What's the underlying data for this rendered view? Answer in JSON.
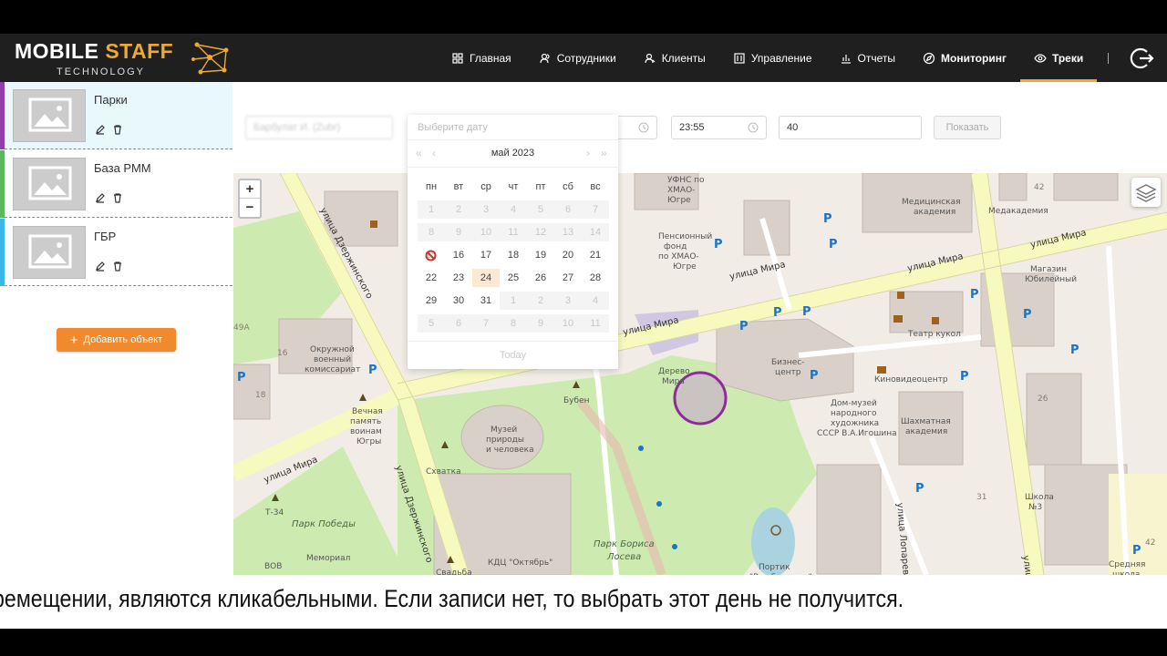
{
  "header": {
    "logo": {
      "main_a": "MOBILE ",
      "main_b": "STAFF",
      "sub": "TECHNOLOGY"
    },
    "nav": [
      {
        "label": "Главная",
        "icon": "grid-icon"
      },
      {
        "label": "Сотрудники",
        "icon": "users-icon"
      },
      {
        "label": "Клиенты",
        "icon": "client-icon"
      },
      {
        "label": "Управление",
        "icon": "manage-icon"
      },
      {
        "label": "Отчеты",
        "icon": "chart-icon"
      },
      {
        "label": "Мониторинг",
        "icon": "compass-icon"
      },
      {
        "label": "Треки",
        "icon": "eye-icon"
      }
    ],
    "logout_icon": "logout-icon"
  },
  "sidebar": {
    "objects": [
      {
        "title": "Парки",
        "color": "#8e3fa8"
      },
      {
        "title": "База РММ",
        "color": "#5cb85c"
      },
      {
        "title": "ГБР",
        "color": "#38b7e8"
      }
    ],
    "add_label": "Добавить объект"
  },
  "filter": {
    "employee": "Барбулат И. (Zubr)",
    "time_to": "23:55",
    "distance": "40",
    "show_label": "Показать"
  },
  "calendar": {
    "placeholder": "Выберите дату",
    "month": "май 2023",
    "weekdays": [
      "пн",
      "вт",
      "ср",
      "чт",
      "пт",
      "сб",
      "вс"
    ],
    "weeks": [
      [
        [
          "1",
          "dis"
        ],
        [
          "2",
          "dis"
        ],
        [
          "3",
          "dis"
        ],
        [
          "4",
          "dis"
        ],
        [
          "5",
          "dis"
        ],
        [
          "6",
          "dis"
        ],
        [
          "7",
          "dis"
        ]
      ],
      [
        [
          "8",
          "dis"
        ],
        [
          "9",
          "dis"
        ],
        [
          "10",
          "dis"
        ],
        [
          "11",
          "dis"
        ],
        [
          "12",
          "dis"
        ],
        [
          "13",
          "dis"
        ],
        [
          "14",
          "dis"
        ]
      ],
      [
        [
          "15",
          "ban"
        ],
        [
          "16",
          ""
        ],
        [
          "17",
          ""
        ],
        [
          "18",
          ""
        ],
        [
          "19",
          ""
        ],
        [
          "20",
          ""
        ],
        [
          "21",
          ""
        ]
      ],
      [
        [
          "22",
          ""
        ],
        [
          "23",
          ""
        ],
        [
          "24",
          "cur"
        ],
        [
          "25",
          ""
        ],
        [
          "26",
          ""
        ],
        [
          "27",
          ""
        ],
        [
          "28",
          ""
        ]
      ],
      [
        [
          "29",
          ""
        ],
        [
          "30",
          ""
        ],
        [
          "31",
          ""
        ],
        [
          "1",
          "dis"
        ],
        [
          "2",
          "dis"
        ],
        [
          "3",
          "dis"
        ],
        [
          "4",
          "dis"
        ]
      ],
      [
        [
          "5",
          "dis"
        ],
        [
          "6",
          "dis"
        ],
        [
          "7",
          "dis"
        ],
        [
          "8",
          "dis"
        ],
        [
          "9",
          "dis"
        ],
        [
          "10",
          "dis"
        ],
        [
          "11",
          "dis"
        ]
      ]
    ],
    "today_label": "Today"
  },
  "map": {
    "streets": [
      "улица Дзержинского",
      "улица Мира",
      "улица Мира",
      "улица Мира",
      "улица Дзержинского",
      "улица Мира",
      "улица Мира",
      "улица Лопарева",
      "улица Ка"
    ],
    "pois": [
      "Пенсионный фонд по ХМАО-Югре",
      "Медицинская академия",
      "Медакадемия",
      "Магазин Юбилейный",
      "Окружной военный комиссариат",
      "Вечная память воинам Югры",
      "Музей природы и человека",
      "Бубен",
      "Дерево Мира",
      "Бизнес-центр",
      "Театр кукол",
      "Киновидеоцентр",
      "Дом-музей народного художника СССР В.А.Игошина",
      "Шахматная академия",
      "Схватка",
      "Парк Победы",
      "Мемориал ВОВ",
      "КДЦ \"Октябрь\"",
      "Свадьба",
      "Парк Бориса Лосева",
      "Портик \"Влюбленных\"",
      "Т-34",
      "Школа №3",
      "Средняя школа",
      "УФНС по ХМАО-Югре"
    ],
    "house_numbers": [
      "42",
      "49А",
      "16",
      "18",
      "26",
      "31",
      "42"
    ]
  },
  "subtitle": "ремещении, являются кликабельными. Если записи нет, то выбрать этот день не получится."
}
